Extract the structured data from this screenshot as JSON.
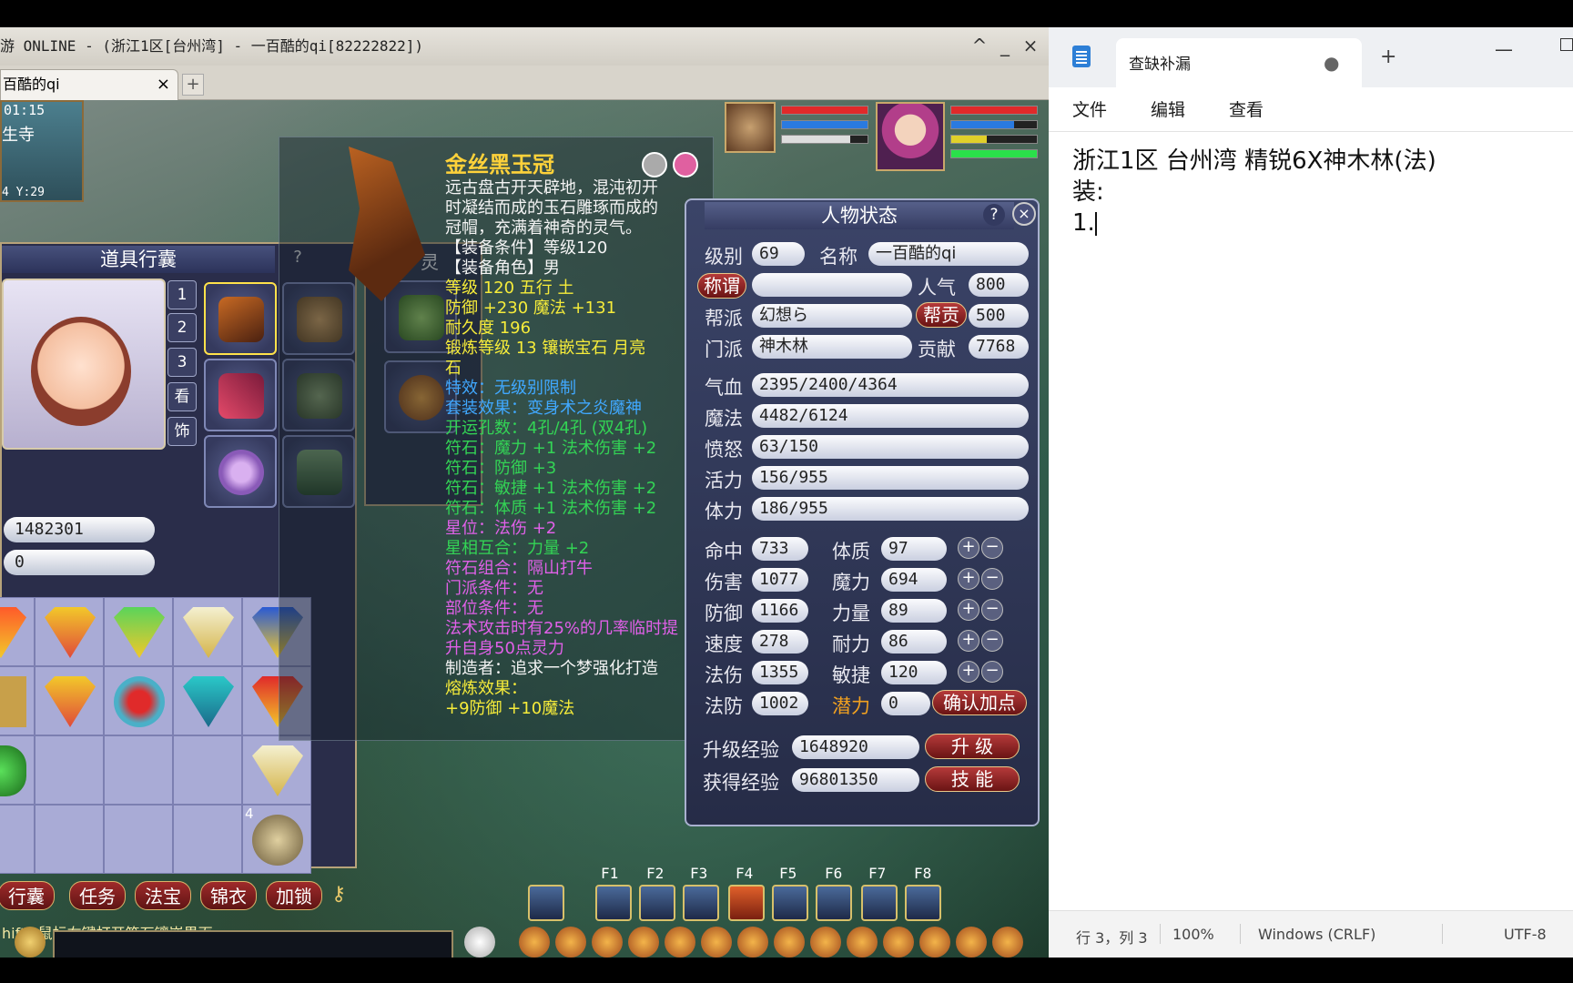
{
  "game": {
    "window_title": "游 ONLINE - (浙江1区[台州湾] - 一百酷的qi[82222822])",
    "tab_label": "百酷的qi",
    "tab_close": "×",
    "new_tab": "+",
    "controls": {
      "restore": "^",
      "minimize": "_",
      "close": "×"
    },
    "minimap": {
      "clock": "01:15",
      "location": "生寺",
      "coords": "4  Y:29"
    },
    "inventory": {
      "title": "道具行囊",
      "help": "?",
      "money": "1482301",
      "money2": "0",
      "side_tabs": [
        "1",
        "2",
        "3",
        "看",
        "饰"
      ],
      "buttons": [
        "行囊",
        "任务",
        "法宝",
        "锦衣",
        "加锁"
      ],
      "stack_count": "4",
      "hint": "hift+鼠标右键打开符石镶嵌界面。"
    },
    "panel2_label": "灵",
    "tooltip": {
      "title": "金丝黑玉冠",
      "lines": [
        {
          "text": "远古盘古开天辟地，混沌初开",
          "color": "white"
        },
        {
          "text": "时凝结而成的玉石雕琢而成的",
          "color": "white"
        },
        {
          "text": "冠帽，充满着神奇的灵气。",
          "color": "white"
        },
        {
          "text": "【装备条件】等级120",
          "color": "white"
        },
        {
          "text": "【装备角色】男",
          "color": "white"
        },
        {
          "text": "等级 120   五行 土",
          "color": "yellow"
        },
        {
          "text": "防御 +230  魔法 +131",
          "color": "yellow"
        },
        {
          "text": "耐久度 196",
          "color": "yellow"
        },
        {
          "text": "锻炼等级 13   镶嵌宝石 月亮",
          "color": "yellow"
        },
        {
          "text": "石",
          "color": "yellow"
        },
        {
          "text": "特效：无级别限制",
          "color": "blue"
        },
        {
          "text": "套装效果：变身术之炎魔神",
          "color": "blue"
        },
        {
          "text": "开运孔数：4孔/4孔 (双4孔)",
          "color": "green"
        },
        {
          "text": "符石：魔力 +1  法术伤害 +2",
          "color": "green"
        },
        {
          "text": "符石：防御 +3",
          "color": "green"
        },
        {
          "text": "符石：敏捷 +1  法术伤害 +2",
          "color": "green"
        },
        {
          "text": "符石：体质 +1  法术伤害 +2",
          "color": "green"
        },
        {
          "text": "星位：法伤 +2",
          "color": "purple"
        },
        {
          "text": "星相互合：力量 +2",
          "color": "green"
        },
        {
          "text": "符石组合：隔山打牛",
          "color": "purple"
        },
        {
          "text": "门派条件：无",
          "color": "purple"
        },
        {
          "text": "部位条件：无",
          "color": "purple"
        },
        {
          "text": "法术攻击时有25%的几率临时提",
          "color": "purple"
        },
        {
          "text": "升自身50点灵力",
          "color": "purple"
        },
        {
          "text": "制造者：追求一个梦强化打造",
          "color": "white"
        },
        {
          "text": "熔炼效果：",
          "color": "yellow"
        },
        {
          "text": "+9防御 +10魔法",
          "color": "yellow"
        }
      ]
    },
    "character": {
      "title": "人物状态",
      "help": "?",
      "close": "×",
      "level_label": "级别",
      "level": "69",
      "name_label": "名称",
      "name": "一百酷的qi",
      "title_label": "称谓",
      "title_value": "",
      "popularity_label": "人气",
      "popularity": "800",
      "guild_label": "帮派",
      "guild": "幻想ら",
      "guild_contrib_label": "帮贡",
      "guild_contrib": "500",
      "school_label": "门派",
      "school": "神木林",
      "contrib_label": "贡献",
      "contrib": "7768",
      "hp_label": "气血",
      "hp": "2395/2400/4364",
      "mp_label": "魔法",
      "mp": "4482/6124",
      "anger_label": "愤怒",
      "anger": "63/150",
      "vitality_label": "活力",
      "vitality": "156/955",
      "stamina_label": "体力",
      "stamina": "186/955",
      "stats_left": [
        {
          "label": "命中",
          "value": "733"
        },
        {
          "label": "伤害",
          "value": "1077"
        },
        {
          "label": "防御",
          "value": "1166"
        },
        {
          "label": "速度",
          "value": "278"
        },
        {
          "label": "法伤",
          "value": "1355"
        },
        {
          "label": "法防",
          "value": "1002"
        }
      ],
      "stats_right": [
        {
          "label": "体质",
          "value": "97"
        },
        {
          "label": "魔力",
          "value": "694"
        },
        {
          "label": "力量",
          "value": "89"
        },
        {
          "label": "耐力",
          "value": "86"
        },
        {
          "label": "敏捷",
          "value": "120"
        }
      ],
      "potential_label": "潜力",
      "potential": "0",
      "confirm_btn": "确认加点",
      "upgrade_exp_label": "升级经验",
      "upgrade_exp": "1648920",
      "gain_exp_label": "获得经验",
      "gain_exp": "96801350",
      "upgrade_btn": "升 级",
      "skill_btn": "技 能",
      "plus": "+",
      "minus": "−"
    },
    "hotkeys": [
      "F1",
      "F2",
      "F3",
      "F4",
      "F5",
      "F6",
      "F7",
      "F8"
    ]
  },
  "notepad": {
    "tab_title": "查缺补漏",
    "tab_dot": "●",
    "new_tab": "+",
    "minimize": "—",
    "menu": [
      "文件",
      "编辑",
      "查看"
    ],
    "lines": [
      "浙江1区 台州湾 精锐6X神木林(法)",
      "装:",
      "1."
    ],
    "status": {
      "position": "行 3，列 3",
      "zoom": "100%",
      "line_ending": "Windows (CRLF)",
      "encoding": "UTF-8"
    }
  },
  "colors": {
    "tip_white": "#f4f4f4",
    "tip_yellow": "#f6ec3a",
    "tip_green": "#33d455",
    "tip_blue": "#40a8ff",
    "tip_purple": "#e060e8"
  }
}
